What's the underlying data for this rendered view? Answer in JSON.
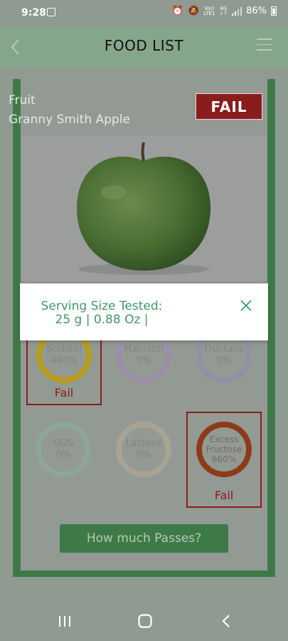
{
  "status_bar": {
    "time": "9:28",
    "carrier_line1": "Vo))",
    "carrier_line2": "LTE1",
    "net_line1": "4G",
    "net_line2": "↓↑",
    "battery_percent": "86%"
  },
  "header": {
    "title": "FOOD LIST"
  },
  "food": {
    "category": "Fruit",
    "name": "Granny Smith Apple",
    "result_badge": "FAIL"
  },
  "nutrients": [
    {
      "label": "Sorbitol",
      "value": "440%",
      "color": "#b89b1f",
      "status": "Fail"
    },
    {
      "label": "Mannitol",
      "value": "0%",
      "color": "#9c8ea9"
    },
    {
      "label": "Fructans",
      "value": "0%",
      "color": "#8e93a3"
    },
    {
      "label": "GOS",
      "value": "0%",
      "color": "#8ea59b"
    },
    {
      "label": "Lactose",
      "value": "0%",
      "color": "#a7a494"
    },
    {
      "label": "Excess Fructose",
      "label_lines": [
        "Excess",
        "Fructose"
      ],
      "value": "660%",
      "color": "#8c3b1a",
      "status": "Fail"
    }
  ],
  "passes_button": "How much Passes?",
  "dialog": {
    "title": "Serving Size Tested:",
    "value": "25 g | 0.88 Oz |"
  },
  "colors": {
    "accent_green": "#3e7a48",
    "fail_red": "#8a1c1c",
    "dialog_text": "#3f9a6b"
  }
}
